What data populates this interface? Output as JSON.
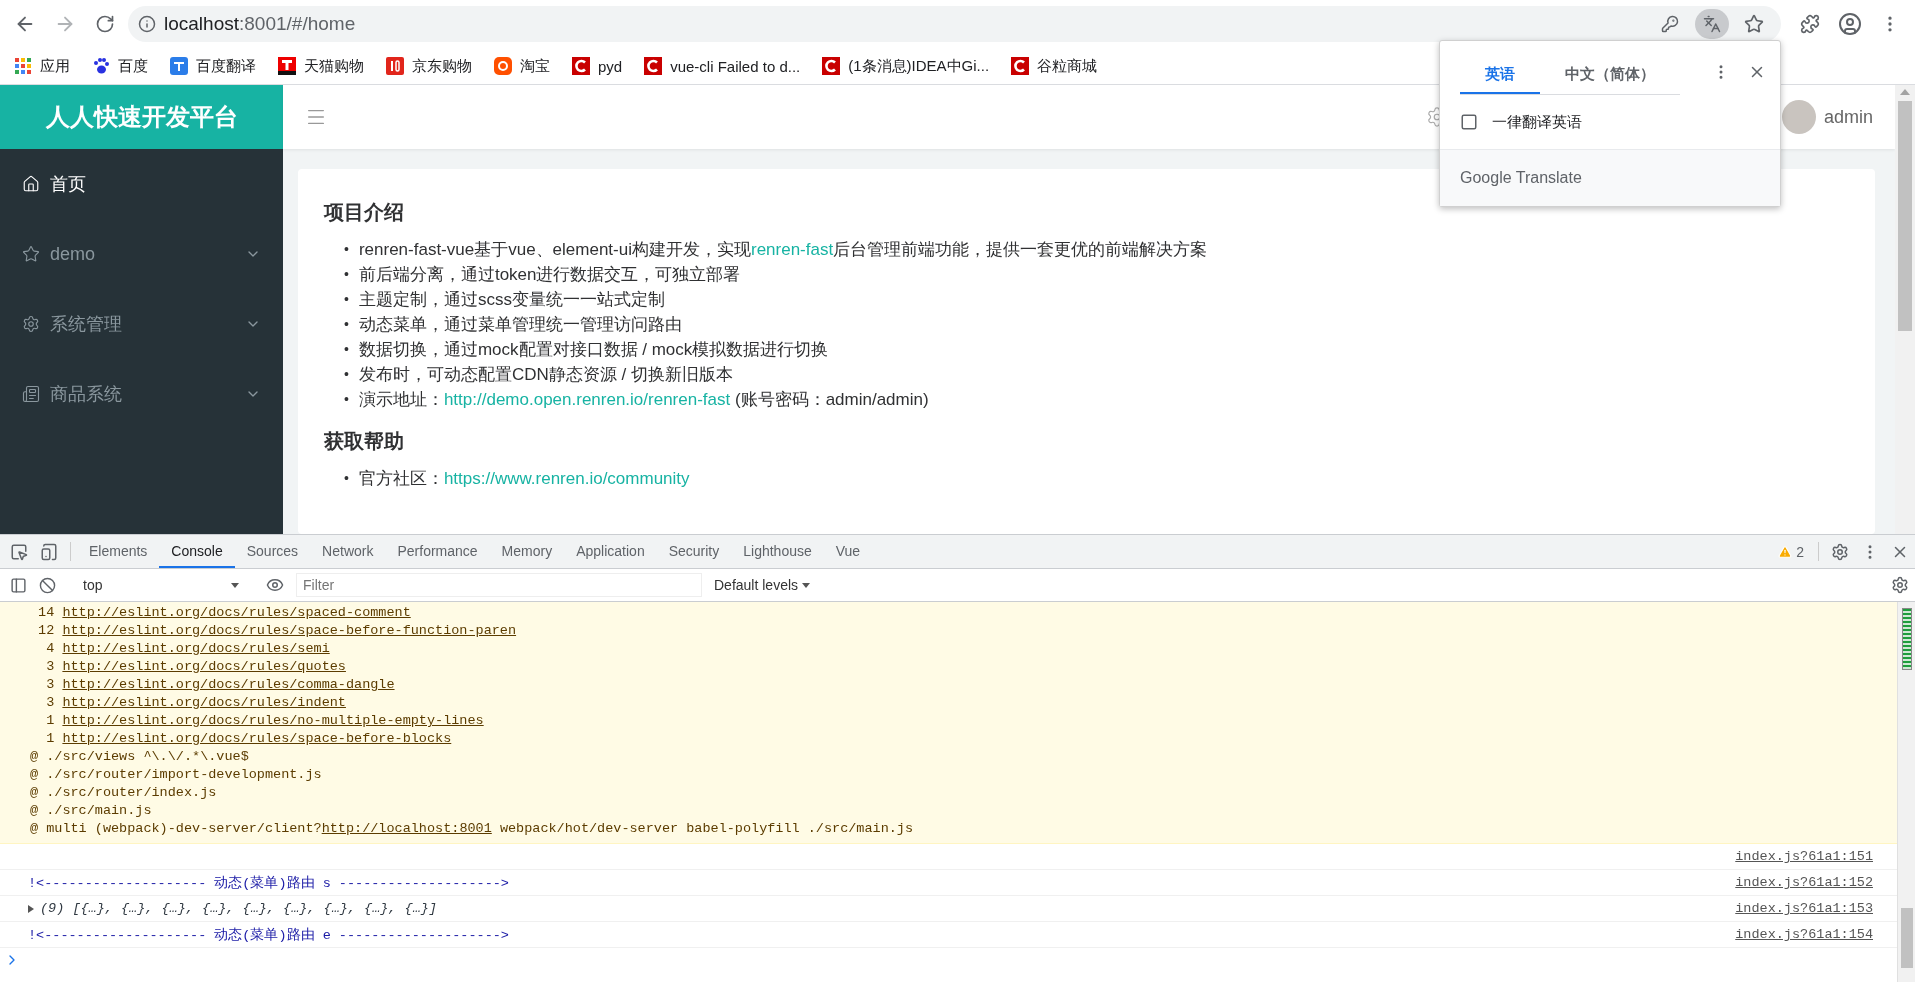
{
  "browser": {
    "url_host": "localhost",
    "url_path": ":8001/#/home"
  },
  "bookmarks": [
    {
      "label": "应用",
      "kind": "apps"
    },
    {
      "label": "百度",
      "kind": "paw"
    },
    {
      "label": "百度翻译",
      "kind": "translate"
    },
    {
      "label": "天猫购物",
      "kind": "tmall"
    },
    {
      "label": "京东购物",
      "kind": "jd"
    },
    {
      "label": "淘宝",
      "kind": "taobao"
    },
    {
      "label": "pyd",
      "kind": "csdn"
    },
    {
      "label": "vue-cli Failed to d...",
      "kind": "csdn"
    },
    {
      "label": "(1条消息)IDEA中Gi...",
      "kind": "csdn"
    },
    {
      "label": "谷粒商城",
      "kind": "csdn"
    }
  ],
  "translate_popup": {
    "tabs": [
      {
        "label": "英语",
        "selected": true
      },
      {
        "label": "中文（简体）",
        "selected": false
      }
    ],
    "option": {
      "label": "一律翻译英语",
      "checked": false
    },
    "footer": "Google Translate"
  },
  "app": {
    "logo": "人人快速开发平台",
    "user": "admin",
    "sidebar": [
      {
        "label": "首页",
        "kind": "home",
        "selected": true,
        "expandable": false
      },
      {
        "label": "demo",
        "kind": "star",
        "selected": false,
        "expandable": true
      },
      {
        "label": "系统管理",
        "kind": "gear",
        "selected": false,
        "expandable": true
      },
      {
        "label": "商品系统",
        "kind": "list",
        "selected": false,
        "expandable": true
      }
    ],
    "sections": [
      {
        "heading": "项目介绍",
        "items": [
          {
            "bullet": "•",
            "parts": [
              {
                "kind": "text",
                "text": "renren-fast-vue基于vue、element-ui构建开发，实现"
              },
              {
                "kind": "link",
                "text": "renren-fast"
              },
              {
                "kind": "text",
                "text": "后台管理前端功能，提供一套更优的前端解决方案"
              }
            ]
          },
          {
            "bullet": "•",
            "parts": [
              {
                "kind": "text",
                "text": "前后端分离，通过token进行数据交互，可独立部署"
              }
            ]
          },
          {
            "bullet": "•",
            "parts": [
              {
                "kind": "text",
                "text": "主题定制，通过scss变量统一一站式定制"
              }
            ]
          },
          {
            "bullet": "•",
            "parts": [
              {
                "kind": "text",
                "text": "动态菜单，通过菜单管理统一管理访问路由"
              }
            ]
          },
          {
            "bullet": "•",
            "parts": [
              {
                "kind": "text",
                "text": "数据切换，通过mock配置对接口数据 / mock模拟数据进行切换"
              }
            ]
          },
          {
            "bullet": "•",
            "parts": [
              {
                "kind": "text",
                "text": "发布时，可动态配置CDN静态资源 / 切换新旧版本"
              }
            ]
          },
          {
            "bullet": "•",
            "parts": [
              {
                "kind": "text",
                "text": "演示地址："
              },
              {
                "kind": "link",
                "text": "http://demo.open.renren.io/renren-fast"
              },
              {
                "kind": "text",
                "text": " (账号密码：admin/admin)"
              }
            ]
          }
        ]
      },
      {
        "heading": "获取帮助",
        "items": [
          {
            "bullet": "•",
            "parts": [
              {
                "kind": "text",
                "text": "官方社区："
              },
              {
                "kind": "link",
                "text": "https://www.renren.io/community"
              }
            ]
          }
        ]
      }
    ]
  },
  "devtools": {
    "tabs": [
      {
        "label": "Elements",
        "selected": false
      },
      {
        "label": "Console",
        "selected": true
      },
      {
        "label": "Sources",
        "selected": false
      },
      {
        "label": "Network",
        "selected": false
      },
      {
        "label": "Performance",
        "selected": false
      },
      {
        "label": "Memory",
        "selected": false
      },
      {
        "label": "Application",
        "selected": false
      },
      {
        "label": "Security",
        "selected": false
      },
      {
        "label": "Lighthouse",
        "selected": false
      },
      {
        "label": "Vue",
        "selected": false
      }
    ],
    "warning_count": "2",
    "context": "top",
    "filter_placeholder": "Filter",
    "levels": "Default levels",
    "warning_rules": [
      {
        "count": "14",
        "url": "http://eslint.org/docs/rules/spaced-comment"
      },
      {
        "count": "12",
        "url": "http://eslint.org/docs/rules/space-before-function-paren"
      },
      {
        "count": "4",
        "url": "http://eslint.org/docs/rules/semi"
      },
      {
        "count": "3",
        "url": "http://eslint.org/docs/rules/quotes"
      },
      {
        "count": "3",
        "url": "http://eslint.org/docs/rules/comma-dangle"
      },
      {
        "count": "3",
        "url": "http://eslint.org/docs/rules/indent"
      },
      {
        "count": "1",
        "url": "http://eslint.org/docs/rules/no-multiple-empty-lines"
      },
      {
        "count": "1",
        "url": "http://eslint.org/docs/rules/space-before-blocks"
      }
    ],
    "warning_stack": [
      [
        {
          "kind": "text",
          "text": "@ ./src/views ^\\.\\/.*\\.vue$"
        }
      ],
      [
        {
          "kind": "text",
          "text": "@ ./src/router/import-development.js"
        }
      ],
      [
        {
          "kind": "text",
          "text": "@ ./src/router/index.js"
        }
      ],
      [
        {
          "kind": "text",
          "text": "@ ./src/main.js"
        }
      ],
      [
        {
          "kind": "text",
          "text": "@ multi (webpack)-dev-server/client?"
        },
        {
          "kind": "link",
          "text": "http://localhost:8001"
        },
        {
          "kind": "text",
          "text": " webpack/hot/dev-server babel-polyfill ./src/main.js"
        }
      ]
    ],
    "messages": [
      {
        "kind": "blank",
        "source": "index.js?61a1:151"
      },
      {
        "kind": "text",
        "text": "!<-------------------- 动态(菜单)路由 s -------------------->",
        "source": "index.js?61a1:152"
      },
      {
        "kind": "array",
        "text": "(9) [{…}, {…}, {…}, {…}, {…}, {…}, {…}, {…}, {…}]",
        "expanded": false,
        "source": "index.js?61a1:153"
      },
      {
        "kind": "text",
        "text": "!<-------------------- 动态(菜单)路由 e -------------------->",
        "source": "index.js?61a1:154"
      }
    ]
  }
}
